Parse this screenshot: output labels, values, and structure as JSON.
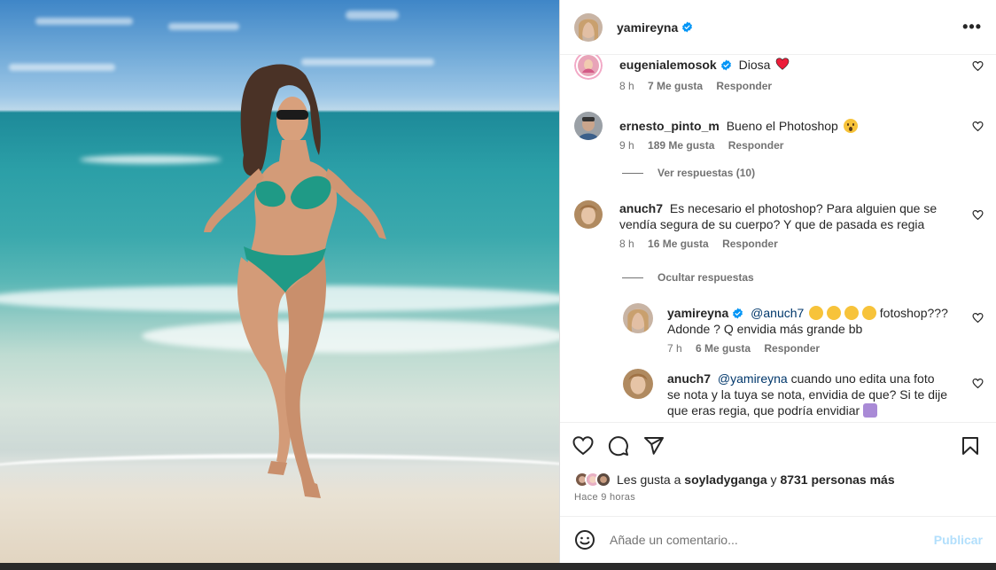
{
  "post": {
    "author": "yamireyna",
    "author_verified": true
  },
  "comments": [
    {
      "user": "eugenialemosok",
      "verified": true,
      "text": "Diosa",
      "emoji": "red-heart",
      "time": "8 h",
      "likes": "7 Me gusta",
      "reply_label": "Responder"
    },
    {
      "user": "ernesto_pinto_m",
      "verified": false,
      "text": "Bueno el Photoshop",
      "emoji": "astonished-face",
      "time": "9 h",
      "likes": "189 Me gusta",
      "reply_label": "Responder",
      "thread_toggle": "Ver respuestas (10)"
    },
    {
      "user": "anuch7",
      "verified": false,
      "text": "Es necesario el photoshop? Para alguien que se vendía segura de su cuerpo? Y que de pasada es regia",
      "time": "8 h",
      "likes": "16 Me gusta",
      "reply_label": "Responder",
      "thread_toggle": "Ocultar respuestas",
      "replies": [
        {
          "user": "yamireyna",
          "verified": true,
          "mention": "@anuch7",
          "emojis": [
            "grinning-squinting-face",
            "grinning-squinting-face",
            "grinning-squinting-face",
            "grinning-squinting-face"
          ],
          "text": "fotoshop??? Adonde ? Q envidia más grande bb",
          "time": "7 h",
          "likes": "6 Me gusta",
          "reply_label": "Responder"
        },
        {
          "user": "anuch7",
          "verified": false,
          "mention": "@yamireyna",
          "text": "cuando uno edita una foto se nota y la tuya se nota, envidia de que? Si te dije que eras regia, que podría envidiar",
          "emoji": "person-shrugging"
        }
      ]
    }
  ],
  "actions": {
    "like_icon": "heart-outline-icon",
    "comment_icon": "comment-bubble-icon",
    "share_icon": "paper-plane-icon",
    "save_icon": "bookmark-icon"
  },
  "likes_summary": {
    "prefix": "Les gusta a",
    "first_user": "soyladyganga",
    "connector": "y",
    "others": "8731 personas más"
  },
  "time_ago": "Hace 9 horas",
  "add_comment": {
    "emoji_icon": "smiley-icon",
    "placeholder": "Añade un comentario...",
    "publish_label": "Publicar"
  },
  "colors": {
    "verified_blue": "#0095f6",
    "heart_red": "#ed1d3a",
    "publish_disabled": "#b2dffc",
    "mention_blue": "#00376b"
  }
}
